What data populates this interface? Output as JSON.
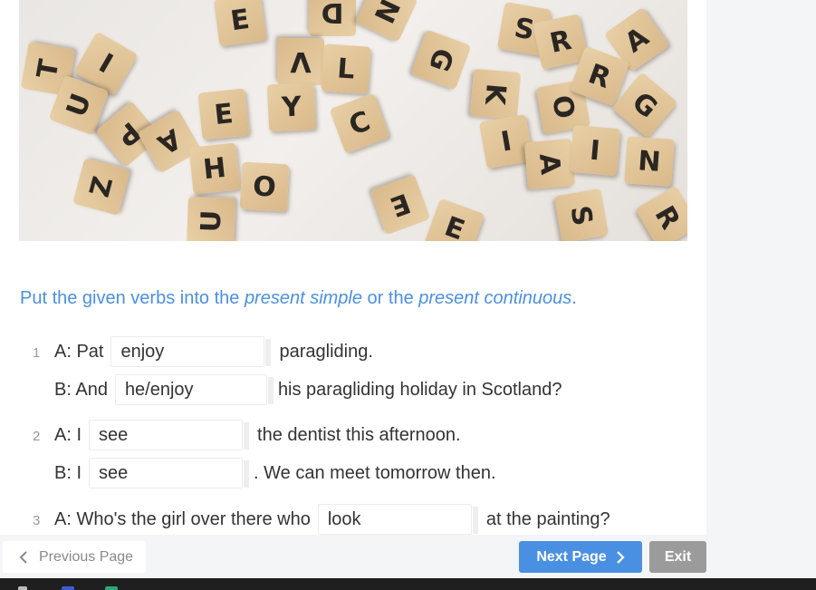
{
  "photo": {
    "tiles": [
      "E",
      "D",
      "N",
      "S",
      "R",
      "T",
      "I",
      "V",
      "L",
      "G",
      "A",
      "O",
      "U",
      "E",
      "Y",
      "K",
      "R",
      "P",
      "A",
      "C",
      "G",
      "N",
      "H",
      "O",
      "I",
      "A",
      "E",
      "I",
      "S",
      "R",
      "Z",
      "U",
      "E"
    ]
  },
  "instruction": {
    "part1": "Put the given verbs into the ",
    "term1": "present simple",
    "part2": " or the ",
    "term2": "present continuous",
    "part3": "."
  },
  "exercises": [
    {
      "number": "1",
      "lines": [
        {
          "before": "A: Pat",
          "blank": "enjoy",
          "after": "paragliding."
        },
        {
          "before": "B: And",
          "blank": "he/enjoy",
          "after": "his paragliding holiday in Scotland?"
        }
      ]
    },
    {
      "number": "2",
      "lines": [
        {
          "before": "A: I",
          "blank": "see",
          "after": "the dentist this afternoon."
        },
        {
          "before": "B: I",
          "blank": "see",
          "after": ". We can meet tomorrow then."
        }
      ]
    },
    {
      "number": "3",
      "lines": [
        {
          "before": "A: Who's the girl over there who",
          "blank": "look",
          "after": "at the painting?"
        }
      ]
    }
  ],
  "footer": {
    "previous_label": "Previous Page",
    "next_label": "Next Page",
    "exit_label": "Exit"
  },
  "colors": {
    "accent": "#4a90e2",
    "exit_button": "#9b9b9b",
    "taskbar": "#1f1f1f"
  }
}
